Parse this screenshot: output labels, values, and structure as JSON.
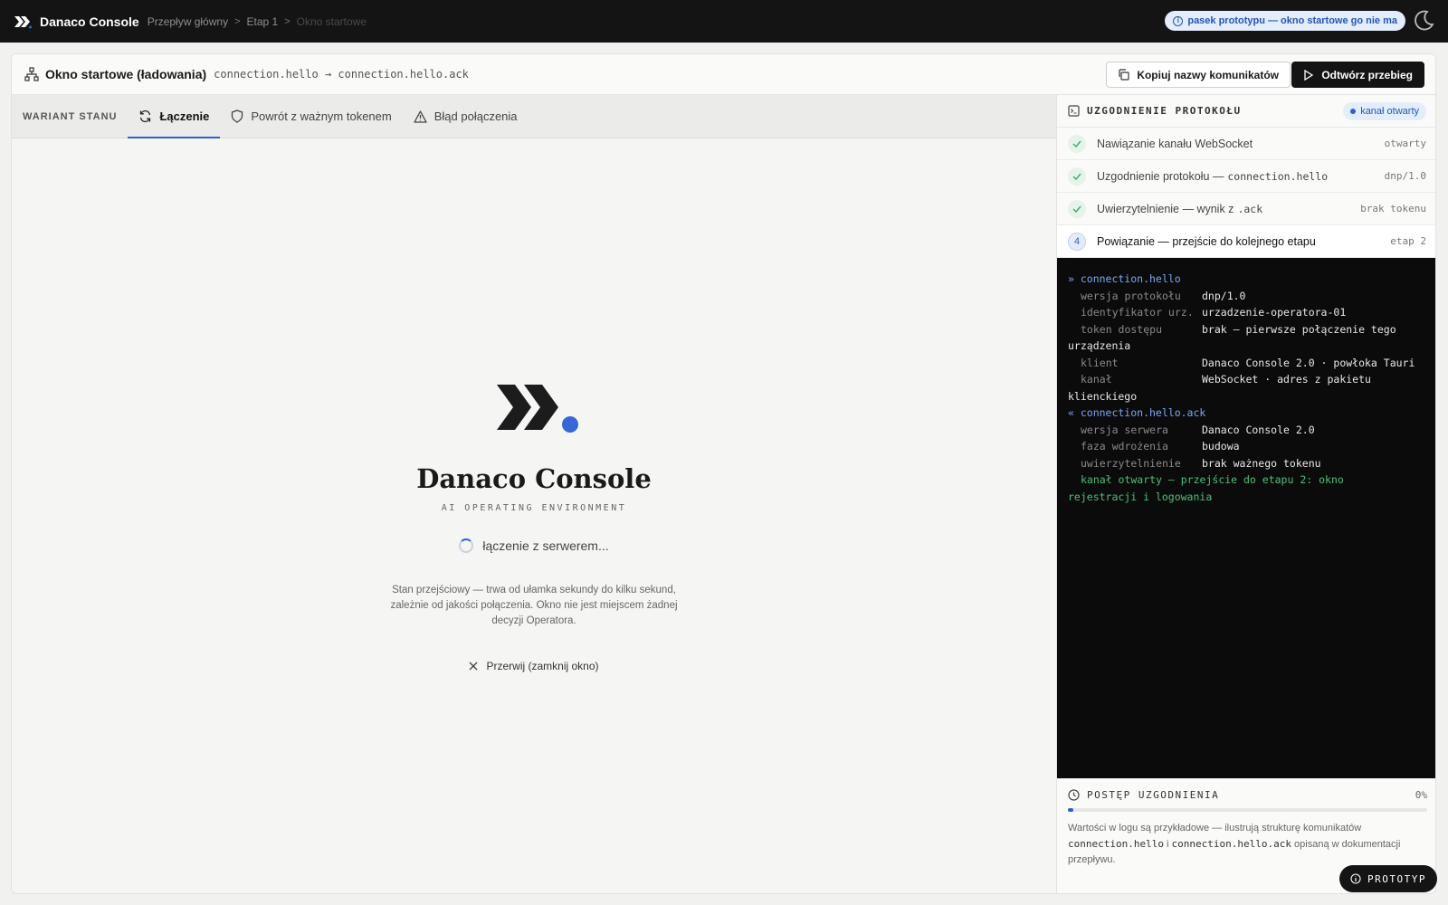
{
  "topbar": {
    "app_title": "Danaco Console",
    "breadcrumbs": [
      "Przepływ główny",
      "Etap 1",
      "Okno startowe"
    ],
    "prototype_pill": "pasek prototypu — okno startowe go nie ma",
    "theme_icon": "moon-icon"
  },
  "header": {
    "title": "Okno startowe (ładowania)",
    "subtitle": "connection.hello → connection.hello.ack",
    "copy_button": "Kopiuj nazwy komunikatów",
    "replay_button": "Odtwórz przebieg"
  },
  "tabs": {
    "label": "WARIANT STANU",
    "items": [
      {
        "label": "Łączenie",
        "icon": "refresh-icon",
        "active": true
      },
      {
        "label": "Powrót z ważnym tokenem",
        "icon": "shield-icon",
        "active": false
      },
      {
        "label": "Błąd połączenia",
        "icon": "warning-icon",
        "active": false
      }
    ]
  },
  "splash": {
    "brand": "Danaco Console",
    "tagline": "AI OPERATING ENVIRONMENT",
    "status": "łączenie z serwerem...",
    "note": "Stan przejściowy — trwa od ułamka sekundy do kilku sekund, zależnie od jakości połączenia. Okno nie jest miejscem żadnej decyzji Operatora.",
    "abort": "Przerwij (zamknij okno)"
  },
  "panel": {
    "title": "UZGODNIENIE PROTOKOŁU",
    "channel_pill": "kanał otwarty",
    "steps": [
      {
        "label": "Nawiązanie kanału WebSocket",
        "code": "",
        "tag": "otwarty",
        "state": "done"
      },
      {
        "label": "Uzgodnienie protokołu — ",
        "code": "connection.hello",
        "tag": "dnp/1.0",
        "state": "done"
      },
      {
        "label": "Uwierzytelnienie — wynik z ",
        "code": ".ack",
        "tag": "brak tokenu",
        "state": "done"
      },
      {
        "label": "Powiązanie — przejście do kolejnego etapu",
        "code": "",
        "tag": "etap 2",
        "state": "current",
        "num": "4"
      }
    ]
  },
  "log": {
    "hello_head": "» connection.hello",
    "hello": [
      {
        "k": "wersja protokołu",
        "v": "dnp/1.0"
      },
      {
        "k": "identyfikator urz.",
        "v": "urzadzenie-operatora-01"
      },
      {
        "k": "token dostępu",
        "v": "brak — pierwsze połączenie tego"
      },
      {
        "k": "",
        "v": "urządzenia"
      },
      {
        "k": "klient",
        "v": "Danaco Console 2.0 · powłoka Tauri"
      },
      {
        "k": "kanał",
        "v": "WebSocket · adres z pakietu"
      },
      {
        "k": "",
        "v": "klienckiego"
      }
    ],
    "ack_head": "« connection.hello.ack",
    "ack": [
      {
        "k": "wersja serwera",
        "v": "Danaco Console 2.0"
      },
      {
        "k": "faza wdrożenia",
        "v": "budowa"
      },
      {
        "k": "uwierzytelnienie",
        "v": "brak ważnego tokenu"
      }
    ],
    "final": "kanał otwarty — przejście do etapu 2: okno",
    "final2": "rejestracji i logowania"
  },
  "progress": {
    "title": "POSTĘP UZGODNIENIA",
    "percent_label": "0%",
    "value": 0,
    "info_a": "Wartości w logu są przykładowe — ilustrują strukturę komunikatów ",
    "info_code1": "connection.hello",
    "info_b": " i ",
    "info_code2": "connection.hello.ack",
    "info_c": " opisaną w dokumentacji przepływu."
  },
  "prototype_button": "PROTOTYP",
  "colors": {
    "accent": "#2f5fd0",
    "dark": "#141414",
    "success": "#4fbf7a"
  }
}
